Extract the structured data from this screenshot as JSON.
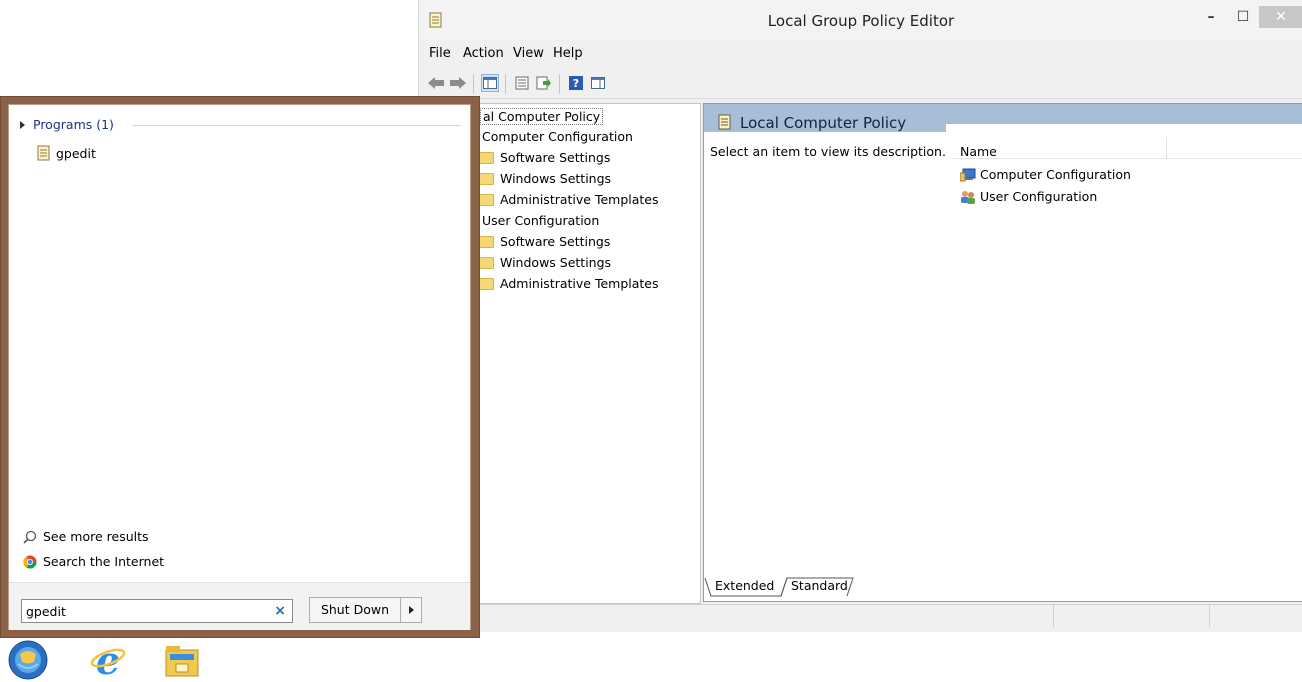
{
  "window": {
    "title": "Local Group Policy Editor",
    "minimize": "–",
    "maximize": "☐",
    "close": "✕"
  },
  "menu": [
    "File",
    "Action",
    "View",
    "Help"
  ],
  "toolbar": {
    "icons": [
      "back-arrow-icon",
      "forward-arrow-icon",
      "show-hide-tree-icon",
      "properties-icon",
      "export-list-icon",
      "help-icon",
      "show-action-pane-icon"
    ]
  },
  "tree": {
    "root": "al Computer Policy",
    "computer": "Computer Configuration",
    "computer_children": [
      "Software Settings",
      "Windows Settings",
      "Administrative Templates"
    ],
    "user": "User Configuration",
    "user_children": [
      "Software Settings",
      "Windows Settings",
      "Administrative Templates"
    ]
  },
  "detail": {
    "header": "Local Computer Policy",
    "description": "Select an item to view its description.",
    "column_name": "Name",
    "items": [
      "Computer Configuration",
      "User Configuration"
    ]
  },
  "tabs": [
    "Extended",
    "Standard"
  ],
  "start_menu": {
    "programs_heading": "Programs (1)",
    "result": "gpedit",
    "see_more": "See more results",
    "search_internet": "Search the Internet",
    "search_value": "gpedit",
    "clear": "×",
    "shutdown": "Shut Down"
  },
  "taskbar": {
    "apps": [
      "start-orb-icon",
      "internet-explorer-icon",
      "file-explorer-icon"
    ]
  },
  "colors": {
    "start_frame": "#8b6247",
    "header_blue": "#a8bdd7",
    "link_blue": "#1e3287"
  }
}
